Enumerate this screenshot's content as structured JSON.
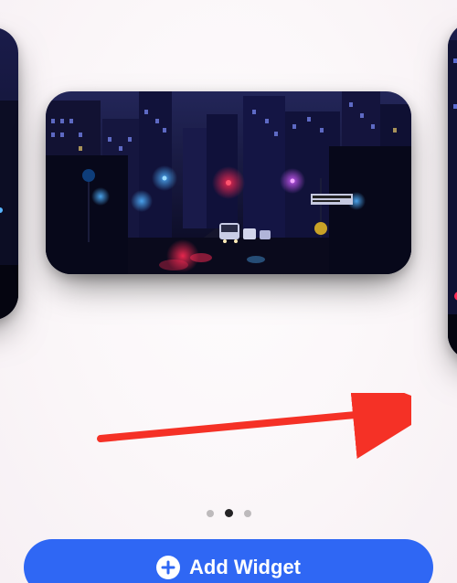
{
  "carousel": {
    "current_index": 1,
    "count": 3
  },
  "add_button": {
    "label": "Add Widget"
  },
  "annotation": {
    "color": "#f53126"
  }
}
